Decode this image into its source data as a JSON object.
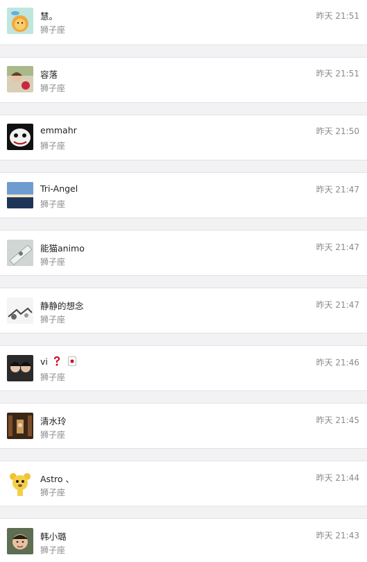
{
  "conversations": [
    {
      "name": "慧。",
      "subtitle": "狮子座",
      "time": "昨天 21:51",
      "avatar_icon": "lion-cartoon-avatar-icon"
    },
    {
      "name": "容落",
      "subtitle": "狮子座",
      "time": "昨天 21:51",
      "avatar_icon": "girl-with-apple-avatar-icon"
    },
    {
      "name": "emmahr",
      "subtitle": "狮子座",
      "time": "昨天 21:50",
      "avatar_icon": "mask-face-avatar-icon"
    },
    {
      "name": "Tri-Angel",
      "subtitle": "狮子座",
      "time": "昨天 21:47",
      "avatar_icon": "sunset-lake-avatar-icon"
    },
    {
      "name": "能猫animo",
      "subtitle": "狮子座",
      "time": "昨天 21:47",
      "avatar_icon": "tilted-photo-avatar-icon"
    },
    {
      "name": "静静的想念",
      "subtitle": "狮子座",
      "time": "昨天 21:47",
      "avatar_icon": "sketch-avatar-icon"
    },
    {
      "name": "vi",
      "subtitle": "狮子座",
      "time": "昨天 21:46",
      "avatar_icon": "two-girls-avatar-icon",
      "emojis": [
        "question-mark-emoji",
        "card-emoji"
      ]
    },
    {
      "name": "清水玲",
      "subtitle": "狮子座",
      "time": "昨天 21:45",
      "avatar_icon": "library-avatar-icon"
    },
    {
      "name": "Astro 、",
      "subtitle": "狮子座",
      "time": "昨天 21:44",
      "avatar_icon": "bear-cartoon-avatar-icon"
    },
    {
      "name": "韩小璐",
      "subtitle": "狮子座",
      "time": "昨天 21:43",
      "avatar_icon": "child-face-avatar-icon"
    }
  ]
}
